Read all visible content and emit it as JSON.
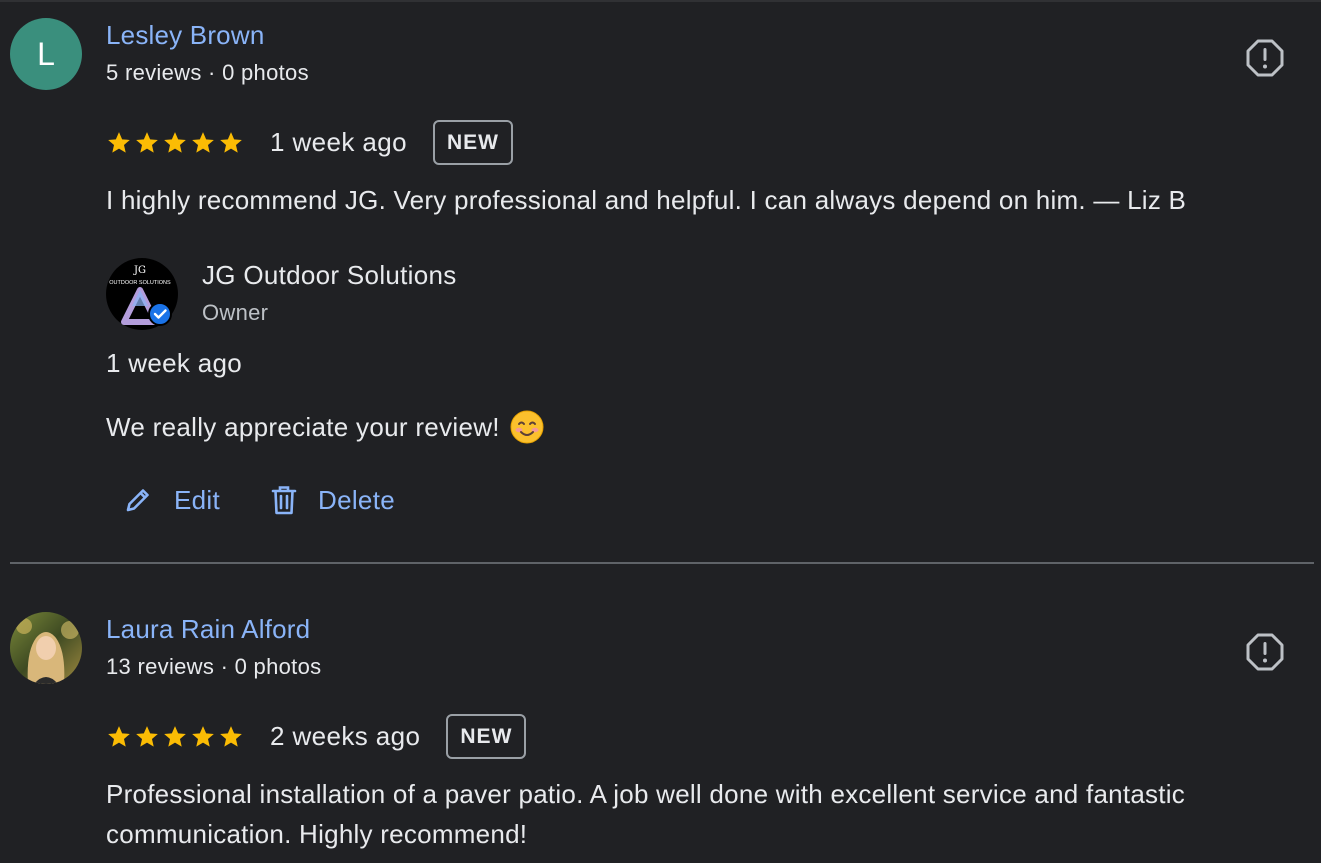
{
  "reviews": [
    {
      "avatar_letter": "L",
      "avatar_color": "#3a8f7d",
      "name": "Lesley Brown",
      "meta": "5 reviews · 0 photos",
      "rating": 5,
      "when": "1 week ago",
      "badge": "NEW",
      "text": "I highly recommend JG. Very professional and helpful. I can always depend on him. — Liz B",
      "owner": {
        "logo_text_top": "JG",
        "logo_text_bottom": "OUTDOOR SOLUTIONS",
        "name": "JG Outdoor Solutions",
        "role": "Owner",
        "when": "1 week ago",
        "reply": "We really appreciate your review!",
        "emoji": "smiling-face-emoji"
      },
      "actions": {
        "edit": "Edit",
        "delete": "Delete"
      }
    },
    {
      "name": "Laura Rain Alford",
      "meta": "13 reviews · 0 photos",
      "rating": 5,
      "when": "2 weeks ago",
      "badge": "NEW",
      "text": "Professional installation of a paver patio. A job well done with excellent service and fantastic communication. Highly recommend!"
    }
  ],
  "colors": {
    "background": "#202124",
    "link": "#8ab4f8",
    "star": "#fbbc04",
    "text": "#e8eaed",
    "divider": "#5f6368"
  },
  "icons": {
    "flag": "report-icon",
    "edit": "pencil-icon",
    "delete": "trash-icon",
    "star": "star-icon",
    "verified": "verified-badge-icon"
  }
}
